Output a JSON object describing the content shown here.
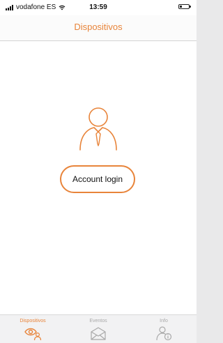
{
  "status_bar": {
    "carrier": "vodafone ES",
    "time": "13:59",
    "battery_level": 0.25,
    "icons": [
      "signal-icon",
      "wifi-icon",
      "battery-icon"
    ]
  },
  "header": {
    "title": "Dispositivos"
  },
  "main": {
    "user_icon": "user-tie-icon",
    "login_button_label": "Account login"
  },
  "tab_bar": {
    "tabs": [
      {
        "label": "Dispositivos",
        "icon": "eye-person-icon",
        "active": true
      },
      {
        "label": "Eventos",
        "icon": "envelope-icon",
        "active": false
      },
      {
        "label": "Info",
        "icon": "person-info-icon",
        "active": false
      }
    ]
  },
  "colors": {
    "accent": "#e8843a",
    "inactive": "#a9a9a9"
  }
}
